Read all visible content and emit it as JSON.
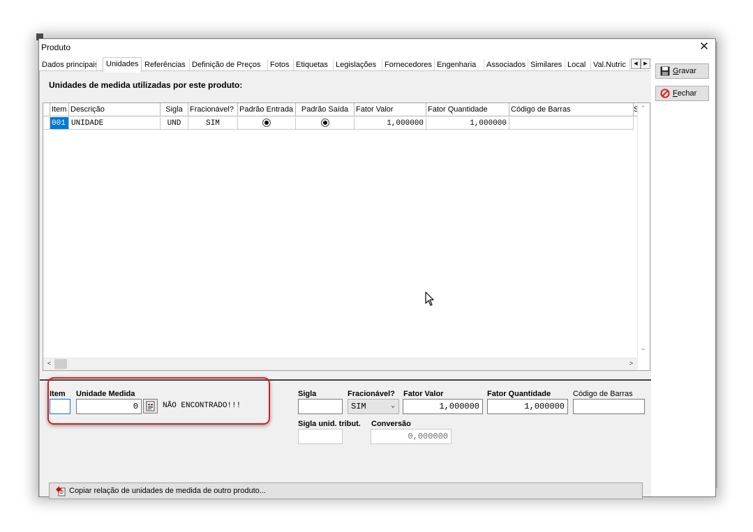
{
  "window": {
    "title": "Produto",
    "close_glyph": "✕"
  },
  "tabs": [
    {
      "label": "Dados principais"
    },
    {
      "label": "Unidades"
    },
    {
      "label": "Referências"
    },
    {
      "label": "Definição de Preços"
    },
    {
      "label": "Fotos"
    },
    {
      "label": "Etiquetas"
    },
    {
      "label": "Legislações"
    },
    {
      "label": "Fornecedores"
    },
    {
      "label": "Engenharia"
    },
    {
      "label": "Associados"
    },
    {
      "label": "Similares"
    },
    {
      "label": "Local"
    },
    {
      "label": "Val.Nutric"
    }
  ],
  "active_tab": "Unidades",
  "heading": "Unidades de medida utilizadas por este produto:",
  "grid": {
    "columns": [
      "Item",
      "Descrição",
      "Sigla",
      "Fracionável?",
      "Padrão Entrada",
      "Padrão Saída",
      "Fator Valor",
      "Fator Quantidade",
      "Código de Barras",
      "S"
    ],
    "rows": [
      {
        "item": "001",
        "descricao": "UNIDADE",
        "sigla": "UND",
        "fracionavel": "SIM",
        "padrao_entrada": true,
        "padrao_saida": true,
        "fator_valor": "1,000000",
        "fator_quantidade": "1,000000",
        "codigo_barras": ""
      }
    ]
  },
  "form": {
    "item_label": "Item",
    "item_value": "",
    "unidade_label": "Unidade Medida",
    "unidade_value": "0",
    "nao_encontrado": "NÃO ENCONTRADO!!!",
    "sigla_label": "Sigla",
    "sigla_value": "",
    "fracionavel_label": "Fracionável?",
    "fracionavel_value": "SIM",
    "fator_valor_label": "Fator Valor",
    "fator_valor_value": "1,000000",
    "fator_quantidade_label": "Fator Quantidade",
    "fator_quantidade_value": "1,000000",
    "codigo_barras_label": "Código de Barras",
    "codigo_barras_value": "",
    "sigla_tribut_label": "Sigla unid. tribut.",
    "sigla_tribut_value": "",
    "conversao_label": "Conversão",
    "conversao_value": "0,000000"
  },
  "copy_button": "Copiar relação de unidades de medida de outro produto...",
  "buttons": {
    "gravar": "Gravar",
    "fechar": "Fechar"
  },
  "colors": {
    "selection": "#0078d7",
    "highlight": "#d81d1d",
    "fechar_icon": "#d42020"
  },
  "icons": [
    "save-icon",
    "cancel-icon",
    "lookup-icon",
    "copy-icon",
    "close-icon",
    "cursor-icon"
  ]
}
